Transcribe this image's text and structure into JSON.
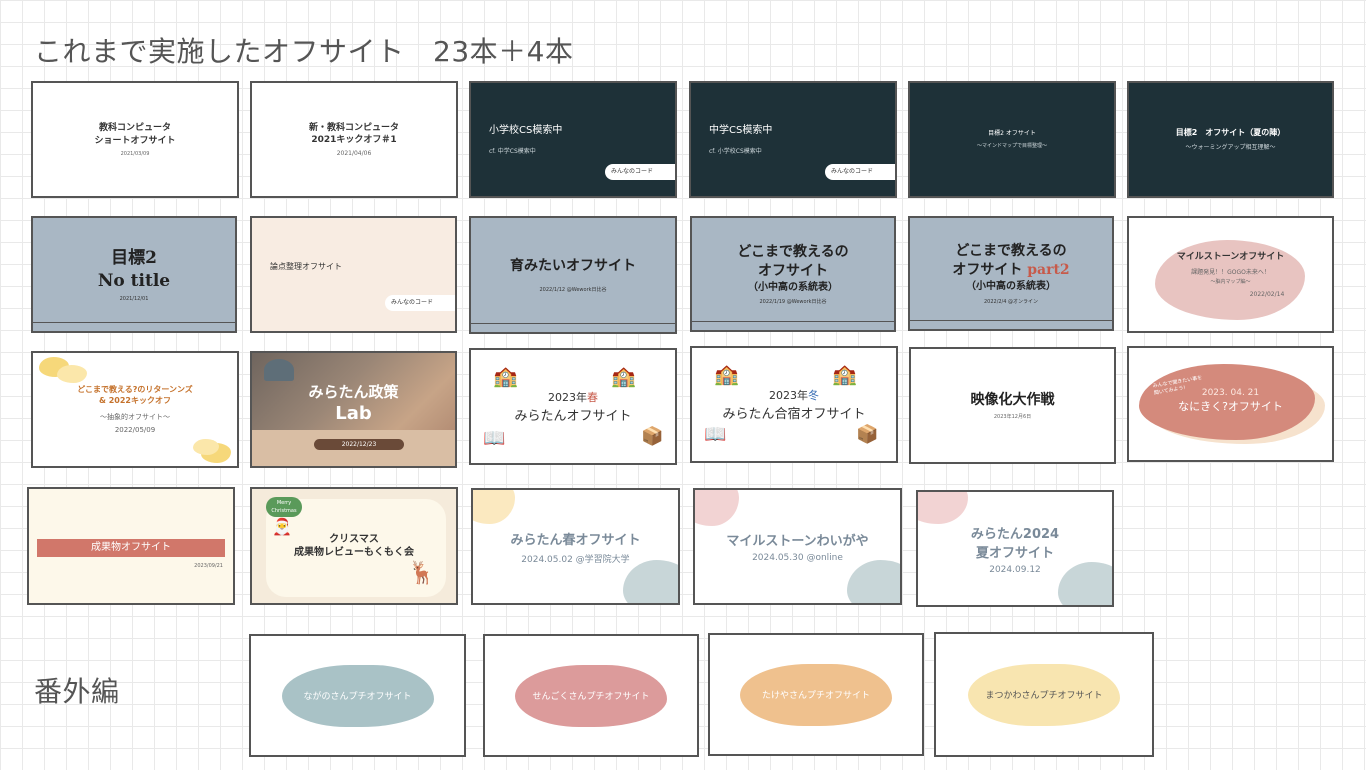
{
  "page": {
    "title": "これまで実施したオフサイト　23本＋4本",
    "extra_title": "番外編"
  },
  "slides": {
    "s1": {
      "title1": "教科コンピュータ",
      "title2": "ショートオフサイト",
      "date": "2021/03/09"
    },
    "s2": {
      "title1": "新・教科コンピュータ",
      "title2": "2021キックオフ＃1",
      "date": "2021/04/06"
    },
    "s3": {
      "title": "小学校CS模索中",
      "sub": "cf. 中学CS模索中",
      "tag": "みんなのコード"
    },
    "s4": {
      "title": "中学CS模索中",
      "sub": "cf. 小学校CS模索中",
      "tag": "みんなのコード"
    },
    "s5": {
      "title": "目標2 オフサイト",
      "sub": "〜マインドマップで目標整理〜"
    },
    "s6": {
      "title": "目標2　オフサイト（夏の陣）",
      "sub": "〜ウォーミングアップ相互理解〜"
    },
    "s7": {
      "title1": "目標2",
      "title2": "No title",
      "date": "2021/12/01"
    },
    "s8": {
      "title": "論点整理オフサイト",
      "tag": "みんなのコード"
    },
    "s9": {
      "title": "育みたいオフサイト",
      "sub": "2022/1/12 @Wework日比谷"
    },
    "s10": {
      "title1": "どこまで教えるの",
      "title2": "オフサイト",
      "title3": "（小中高の系統表）",
      "sub": "2022/1/19 @Wework日比谷"
    },
    "s11": {
      "title1": "どこまで教えるの",
      "title2": "オフサイト",
      "title2b": "part2",
      "title3": "（小中高の系統表）",
      "sub": "2022/2/4 @オンライン"
    },
    "s12": {
      "title": "マイルストーンオフサイト",
      "sub1": "課題発見！！GOGO未来へ！",
      "sub2": "〜脳内マップ編〜",
      "date": "2022/02/14"
    },
    "s13": {
      "title1": "どこまで教える?のリターンンズ",
      "title2": "& 2022キックオフ",
      "sub": "〜抽象的オフサイト〜",
      "date": "2022/05/09"
    },
    "s14": {
      "title1": "みらたん政策",
      "title2": "Lab",
      "date": "2022/12/23"
    },
    "s15": {
      "title1": "2023年",
      "title1b": "春",
      "title2": "みらたんオフサイト"
    },
    "s16": {
      "title1": "2023年",
      "title1b": "冬",
      "title2": "みらたん合宿オフサイト"
    },
    "s17": {
      "title": "映像化大作戦",
      "sub": "2023年12月6日"
    },
    "s18": {
      "title1": "2023. 04. 21",
      "title2": "なにきく?オフサイト",
      "note": "みんなで聞きたい事を聞いてみよう!"
    },
    "s19": {
      "title": "成果物オフサイト",
      "date": "2023/09/21"
    },
    "s20": {
      "title1": "クリスマス",
      "title2": "成果物レビューもくもく会",
      "badge1": "Merry",
      "badge2": "Christmas"
    },
    "s21": {
      "title": "みらたん春オフサイト",
      "sub": "2024.05.02 @学習院大学"
    },
    "s22": {
      "title": "マイルストーンわいがや",
      "sub": "2024.05.30 @online"
    },
    "s23": {
      "title1": "みらたん2024",
      "title2": "夏オフサイト",
      "sub": "2024.09.12"
    }
  },
  "extras": [
    {
      "label": "ながのさんプチオフサイト",
      "color": "#a9c2c6"
    },
    {
      "label": "せんごくさんプチオフサイト",
      "color": "#dc9b9b"
    },
    {
      "label": "たけやさんプチオフサイト",
      "color": "#efc18e"
    },
    {
      "label": "まつかわさんプチオフサイト",
      "color": "#f8e5b0"
    }
  ]
}
